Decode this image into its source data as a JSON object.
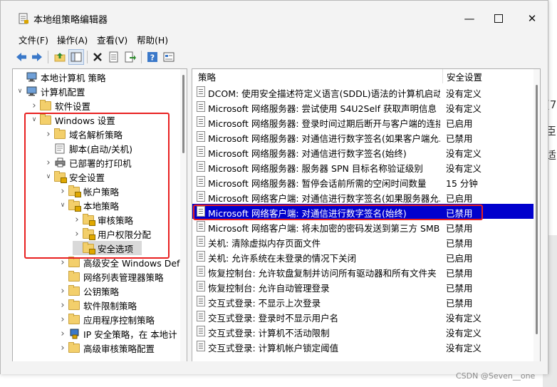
{
  "window": {
    "title": "本地组策略编辑器"
  },
  "menubar": [
    "文件(F)",
    "操作(A)",
    "查看(V)",
    "帮助(H)"
  ],
  "toolbar": {
    "icons": [
      "back-arrow-icon",
      "forward-arrow-icon",
      "up-folder-icon",
      "show-tree-icon",
      "delete-icon",
      "properties-icon",
      "export-icon",
      "help-icon",
      "view-icon"
    ]
  },
  "tree": [
    {
      "label": "本地计算机 策略",
      "icon": "computer-policy-icon",
      "arrow": ""
    },
    {
      "label": "计算机配置",
      "icon": "computer-icon",
      "arrow": "open"
    },
    {
      "label": "软件设置",
      "icon": "folder-icon",
      "arrow": "closed"
    },
    {
      "label": "Windows 设置",
      "icon": "folder-icon",
      "arrow": "open"
    },
    {
      "label": "域名解析策略",
      "icon": "folder-icon",
      "arrow": "closed"
    },
    {
      "label": "脚本(启动/关机)",
      "icon": "script-icon",
      "arrow": ""
    },
    {
      "label": "已部署的打印机",
      "icon": "printer-icon",
      "arrow": "closed"
    },
    {
      "label": "安全设置",
      "icon": "folder-lock-icon",
      "arrow": "open"
    },
    {
      "label": "帐户策略",
      "icon": "folder-lock-icon",
      "arrow": "closed"
    },
    {
      "label": "本地策略",
      "icon": "folder-lock-icon",
      "arrow": "open"
    },
    {
      "label": "审核策略",
      "icon": "folder-lock-icon",
      "arrow": "closed"
    },
    {
      "label": "用户权限分配",
      "icon": "folder-lock-icon",
      "arrow": "closed"
    },
    {
      "label": "安全选项",
      "icon": "folder-lock-icon",
      "arrow": ""
    },
    {
      "label": "高级安全 Windows Def",
      "icon": "folder-icon",
      "arrow": "closed"
    },
    {
      "label": "网络列表管理器策略",
      "icon": "folder-icon",
      "arrow": ""
    },
    {
      "label": "公钥策略",
      "icon": "folder-icon",
      "arrow": "closed"
    },
    {
      "label": "软件限制策略",
      "icon": "folder-icon",
      "arrow": "closed"
    },
    {
      "label": "应用程序控制策略",
      "icon": "folder-icon",
      "arrow": "closed"
    },
    {
      "label": "IP 安全策略，在 本地计",
      "icon": "ip-security-icon",
      "arrow": "closed"
    },
    {
      "label": "高级审核策略配置",
      "icon": "folder-icon",
      "arrow": "closed"
    }
  ],
  "list": {
    "columns": [
      "策略",
      "安全设置"
    ],
    "rows": [
      {
        "policy": "DCOM: 使用安全描述符定义语言(SDDL)语法的计算机启动...",
        "setting": "没有定义"
      },
      {
        "policy": "Microsoft 网络服务器: 尝试使用 S4U2Self 获取声明信息",
        "setting": "没有定义"
      },
      {
        "policy": "Microsoft 网络服务器: 登录时间过期后断开与客户端的连接",
        "setting": "已启用"
      },
      {
        "policy": "Microsoft 网络服务器: 对通信进行数字签名(如果客户端允...",
        "setting": "已禁用"
      },
      {
        "policy": "Microsoft 网络服务器: 对通信进行数字签名(始终)",
        "setting": "没有定义"
      },
      {
        "policy": "Microsoft 网络服务器: 服务器 SPN 目标名称验证级别",
        "setting": "没有定义"
      },
      {
        "policy": "Microsoft 网络服务器: 暂停会话前所需的空闲时间数量",
        "setting": "15 分钟"
      },
      {
        "policy": "Microsoft 网络客户端: 对通信进行数字签名(如果服务器允...",
        "setting": "已启用"
      },
      {
        "policy": "Microsoft 网络客户端: 对通信进行数字签名(始终)",
        "setting": "已禁用",
        "selected": true
      },
      {
        "policy": "Microsoft 网络客户端: 将未加密的密码发送到第三方 SMB...",
        "setting": "已禁用"
      },
      {
        "policy": "关机: 清除虚拟内存页面文件",
        "setting": "已禁用"
      },
      {
        "policy": "关机: 允许系统在未登录的情况下关闭",
        "setting": "已启用"
      },
      {
        "policy": "恢复控制台: 允许软盘复制并访问所有驱动器和所有文件夹",
        "setting": "已禁用"
      },
      {
        "policy": "恢复控制台: 允许自动管理登录",
        "setting": "已禁用"
      },
      {
        "policy": "交互式登录: 不显示上次登录",
        "setting": "已禁用"
      },
      {
        "policy": "交互式登录: 登录时不显示用户名",
        "setting": "没有定义"
      },
      {
        "policy": "交互式登录: 计算机不活动限制",
        "setting": "没有定义"
      },
      {
        "policy": "交互式登录: 计算机帐户锁定阈值",
        "setting": "没有定义"
      }
    ]
  },
  "background": {
    "glyphs": [
      "(7",
      "臣",
      "适"
    ]
  },
  "watermark": "CSDN @Seven__one"
}
